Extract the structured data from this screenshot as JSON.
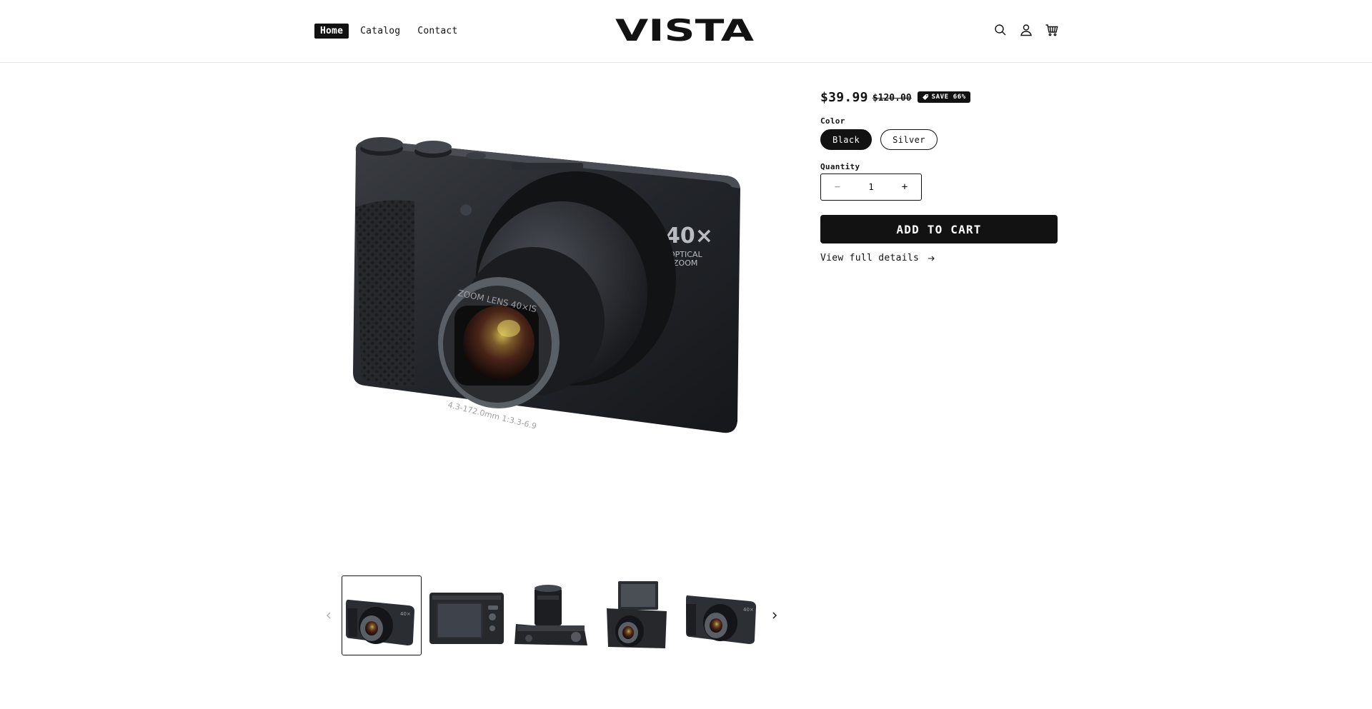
{
  "header": {
    "nav": [
      {
        "label": "Home",
        "active": true
      },
      {
        "label": "Catalog",
        "active": false
      },
      {
        "label": "Contact",
        "active": false
      }
    ],
    "logo_text": "VISTA",
    "icons": [
      "search-icon",
      "account-icon",
      "cart-icon"
    ]
  },
  "product": {
    "price": "$39.99",
    "compare_price": "$120.00",
    "badge": "SAVE 66%",
    "color_label": "Color",
    "colors": [
      {
        "label": "Black",
        "selected": true
      },
      {
        "label": "Silver",
        "selected": false
      }
    ],
    "quantity_label": "Quantity",
    "quantity": "1",
    "minus_symbol": "−",
    "plus_symbol": "+",
    "add_to_cart": "ADD TO CART",
    "details_link": "View full details"
  },
  "main_image": {
    "badge_big": "40×",
    "badge_small_1": "OPTICAL",
    "badge_small_2": "ZOOM",
    "lens_text": "ZOOM LENS 40×IS",
    "lens_text_2": "4.3-172.0mm 1:3.3-6.9"
  },
  "gallery": {
    "thumb_count": 5,
    "selected_index": 0
  },
  "colors": {
    "ink": "#121212",
    "background": "#ffffff",
    "border": "#e6e6e6"
  }
}
